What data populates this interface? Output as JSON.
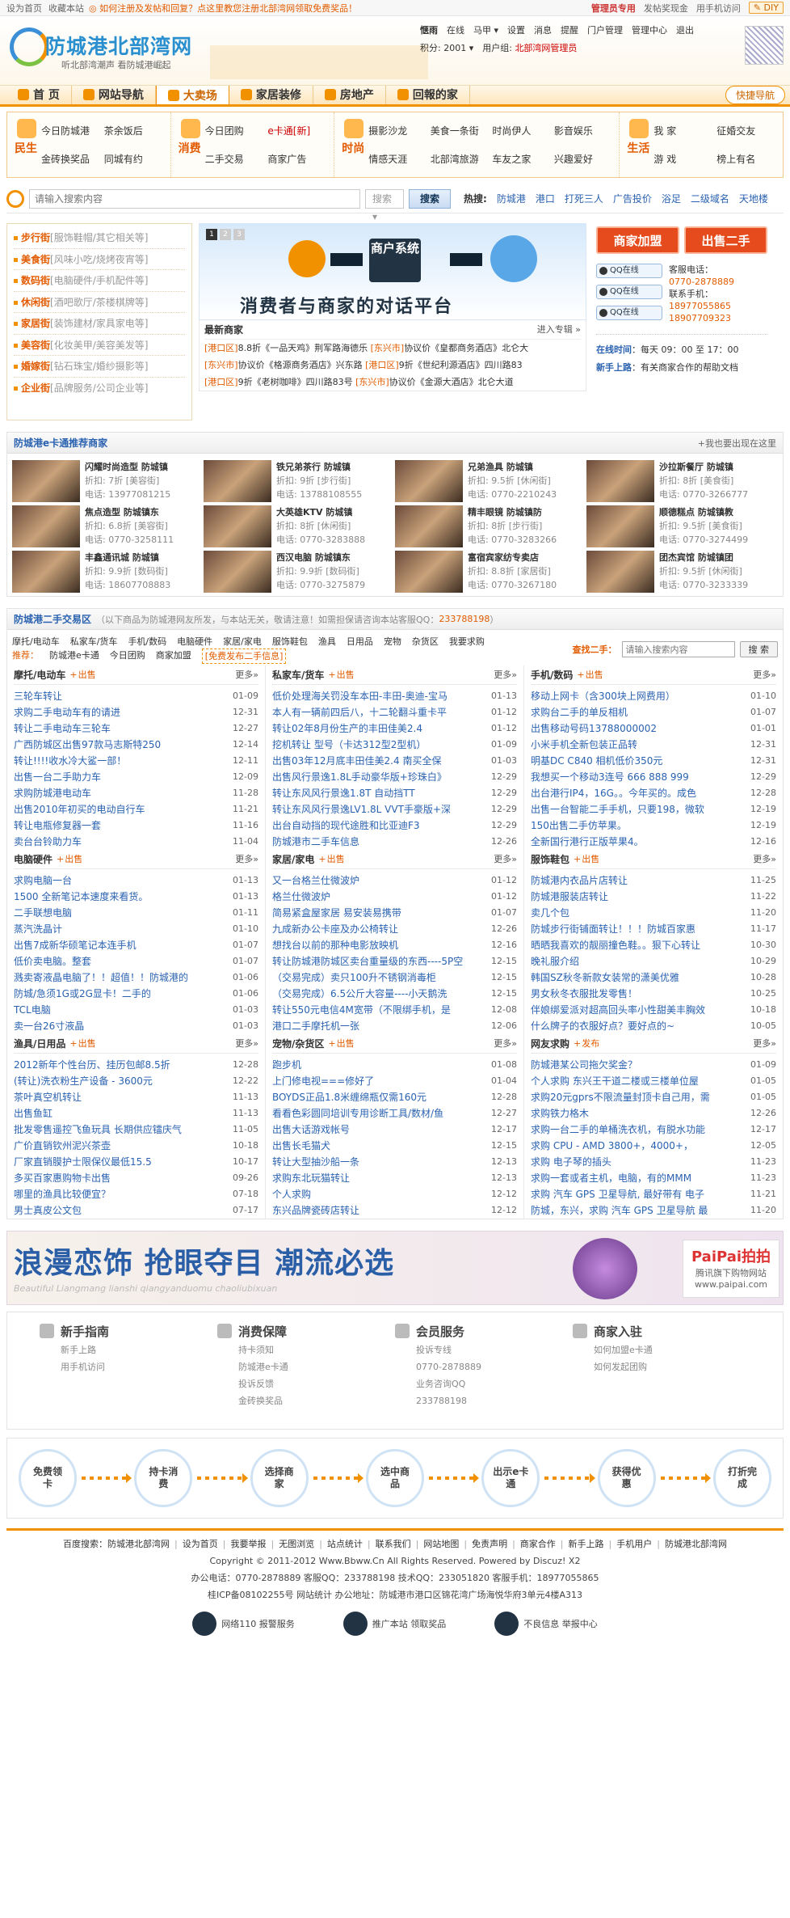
{
  "topbar": {
    "home": "设为首页",
    "fav": "收藏本站",
    "warn": "◎ 如何注册及发帖和回复？点这里教您注册北部湾网领取免费奖品！",
    "links": [
      "管理员专用",
      "发帖奖现金",
      "用手机访问"
    ],
    "diy": "✎ DIY"
  },
  "header": {
    "site_name": "防城港北部湾网",
    "slogan": "听北部湾潮声  看防城港崛起",
    "user": {
      "name": "惬雨",
      "status": "在线",
      "horse": "马甲 ▾",
      "menu": [
        "设置",
        "消息",
        "提醒",
        "门户管理",
        "管理中心",
        "退出"
      ],
      "points_label": "积分: 2001 ▾",
      "group_label": "用户组:",
      "group": "北部湾网管理员"
    }
  },
  "nav": {
    "tabs": [
      "首 页",
      "网站导航",
      "大卖场",
      "家居装修",
      "房地产",
      "回報的家"
    ],
    "quick": "快捷导航"
  },
  "categories": [
    {
      "big": "民生",
      "links": [
        "今日防城港",
        "茶余饭后",
        "金砖换奖品",
        "同城有约"
      ]
    },
    {
      "big": "消费",
      "links": [
        "今日团购",
        "e卡通[新]",
        "二手交易",
        "商家广告"
      ]
    },
    {
      "big": "时尚",
      "links": [
        "摄影沙龙",
        "美食一条街",
        "时尚伊人",
        "影音娱乐",
        "情感天涯",
        "北部湾旅游",
        "车友之家",
        "兴趣爱好"
      ]
    },
    {
      "big": "生活",
      "links": [
        "我 家",
        "征婚交友",
        "游 戏",
        "榜上有名"
      ]
    }
  ],
  "search": {
    "placeholder": "请输入搜索内容",
    "scope": "搜索 ▾",
    "button": "搜索",
    "hot_label": "热搜:",
    "hot": [
      "防城港",
      "港口",
      "打死三人",
      "广告投价",
      "浴足",
      "二级域名",
      "天地楼"
    ]
  },
  "left_cats": [
    {
      "name": "步行街",
      "tags": "[服饰鞋帽/其它相关等]"
    },
    {
      "name": "美食街",
      "tags": "[风味小吃/烧烤夜宵等]"
    },
    {
      "name": "数码街",
      "tags": "[电脑硬件/手机配件等]"
    },
    {
      "name": "休闲街",
      "tags": "[酒吧歌厅/茶楼棋牌等]"
    },
    {
      "name": "家居街",
      "tags": "[装饰建材/家具家电等]"
    },
    {
      "name": "美容街",
      "tags": "[化妆美甲/美容美发等]"
    },
    {
      "name": "婚嫁街",
      "tags": "[钻石珠宝/婚纱摄影等]"
    },
    {
      "name": "企业街",
      "tags": "[品牌服务/公司企业等]"
    }
  ],
  "banner": {
    "pages": [
      "1",
      "2",
      "3"
    ],
    "box": "商户系统",
    "tagline": "消费者与商家的对话平台"
  },
  "newest": {
    "title": "最新商家",
    "more": "进入专辑 »",
    "rows": [
      [
        {
          "loc": "[港口区]",
          "text": "8.8折《一品天鸡》荆军路海德乐"
        },
        {
          "loc": "[东兴市]",
          "text": "协议价《皇都商务酒店》北仑大"
        }
      ],
      [
        {
          "loc": "[东兴市]",
          "text": "协议价《格源商务酒店》兴东路"
        },
        {
          "loc": "[港口区]",
          "text": "9折《世纪利源酒店》四川路83"
        }
      ],
      [
        {
          "loc": "[港口区]",
          "text": "9折《老树咖啡》四川路83号"
        },
        {
          "loc": "[东兴市]",
          "text": "协议价《金源大酒店》北仑大道"
        }
      ]
    ]
  },
  "right": {
    "btn_join": "商家加盟",
    "btn_sell": "出售二手",
    "qq": [
      "QQ在线",
      "QQ在线",
      "QQ在线"
    ],
    "contact": [
      "客服电话：",
      "0770-2878889",
      "联系手机：",
      "18977055865",
      "18907709323"
    ],
    "time_label": "在线时间",
    "time": "：每天 09：00 至 17：00",
    "new_label": "新手上路",
    "new_text": "：有关商家合作的帮助文档"
  },
  "merchants": {
    "title": "防城港e卡通推荐商家",
    "right": "+我也要出现在这里",
    "items": [
      {
        "name": "闪耀时尚造型 防城镇",
        "disc": "折扣: 7折",
        "cat": "[美容街]",
        "tel": "电话: 13977081215"
      },
      {
        "name": "铁兄弟茶行 防城镇",
        "disc": "折扣: 9折",
        "cat": "[步行街]",
        "tel": "电话: 13788108555"
      },
      {
        "name": "兄弟渔具 防城镇",
        "disc": "折扣: 9.5折",
        "cat": "[休闲街]",
        "tel": "电话: 0770-2210243"
      },
      {
        "name": "沙拉斯餐厅 防城镇",
        "disc": "折扣: 8折",
        "cat": "[美食街]",
        "tel": "电话: 0770-3266777"
      },
      {
        "name": "焦点造型 防城镇东",
        "disc": "折扣: 6.8折",
        "cat": "[美容街]",
        "tel": "电话: 0770-3258111"
      },
      {
        "name": "大英雄KTV 防城镇",
        "disc": "折扣: 8折",
        "cat": "[休闲街]",
        "tel": "电话: 0770-3283888"
      },
      {
        "name": "精丰眼镜 防城镇防",
        "disc": "折扣: 8折",
        "cat": "[步行街]",
        "tel": "电话: 0770-3283266"
      },
      {
        "name": "顺德糕点 防城镇教",
        "disc": "折扣: 9.5折",
        "cat": "[美食街]",
        "tel": "电话: 0770-3274499"
      },
      {
        "name": "丰鑫通讯城 防城镇",
        "disc": "折扣: 9.9折",
        "cat": "[数码街]",
        "tel": "电话: 18607708883"
      },
      {
        "name": "西汉电脑 防城镇东",
        "disc": "折扣: 9.9折",
        "cat": "[数码街]",
        "tel": "电话: 0770-3275879"
      },
      {
        "name": "富宿宾家纺专卖店",
        "disc": "折扣: 8.8折",
        "cat": "[家居街]",
        "tel": "电话: 0770-3267180"
      },
      {
        "name": "团杰宾馆 防城镇团",
        "disc": "折扣: 9.5折",
        "cat": "[休闲街]",
        "tel": "电话: 0770-3233339"
      }
    ]
  },
  "trade": {
    "title": "防城港二手交易区",
    "note": "（以下商品为防城港网友所发，与本站无关，敬请注意！如需担保请咨询本站客服QQ：",
    "qq": "233788198",
    "note_end": "）",
    "links": [
      "摩托/电动车",
      "私家车/货车",
      "手机/数码",
      "电脑硬件",
      "家居/家电",
      "服饰鞋包",
      "渔具",
      "日用品",
      "宠物",
      "杂货区",
      "我要求购"
    ],
    "rec_label": "推荐：",
    "rec_links": [
      "防城港e卡通",
      "今日团购",
      "商家加盟"
    ],
    "post": "[免费发布二手信息]",
    "find_label": "查找二手：",
    "find_placeholder": "请输入搜索内容",
    "find_btn": "搜 索"
  },
  "boards": [
    {
      "title": "摩托/电动车",
      "post": "出售",
      "more": "更多»",
      "items": [
        [
          "三轮车转让",
          "01-09"
        ],
        [
          "求购二手电动车有的请进",
          "12-31"
        ],
        [
          "转让二手电动车三轮车",
          "12-27"
        ],
        [
          "广西防城区出售97款马志斯特250",
          "12-14"
        ],
        [
          "转让!!!!收水冷大鲨一部！",
          "12-11"
        ],
        [
          "出售一台二手助力车",
          "12-09"
        ],
        [
          "求购防城港电动车",
          "11-28"
        ],
        [
          "出售2010年初买的电动自行车",
          "11-21"
        ],
        [
          "转让电瓶修复器一套",
          "11-16"
        ],
        [
          "卖台台铃助力车",
          "11-04"
        ]
      ]
    },
    {
      "title": "私家车/货车",
      "post": "出售",
      "more": "更多»",
      "items": [
        [
          "低价处理海关罚没车本田-丰田-奥迪-宝马",
          "01-13"
        ],
        [
          "本人有一辆前四后八，十二轮翻斗重卡平",
          "01-12"
        ],
        [
          "转让02年8月份生产的丰田佳美2.4",
          "01-12"
        ],
        [
          "挖机转让 型号（卡达312型2型机）",
          "01-09"
        ],
        [
          "出售03年12月底丰田佳美2.4 南买全保",
          "01-03"
        ],
        [
          "出售风行景逸1.8L手动豪华版+珍珠白》",
          "12-29"
        ],
        [
          "转让东风风行景逸1.8T 自动挡TT",
          "12-29"
        ],
        [
          "转让东风风行景逸LV1.8L VVT手豪版+深",
          "12-29"
        ],
        [
          "出台自动挡的现代途胜和比亚迪F3",
          "12-29"
        ],
        [
          "防城港市二手车信息",
          "12-26"
        ]
      ]
    },
    {
      "title": "手机/数码",
      "post": "出售",
      "more": "更多»",
      "items": [
        [
          "移动上网卡（含300块上网费用）",
          "01-10"
        ],
        [
          "求购台二手的单反相机",
          "01-07"
        ],
        [
          "出售移动号码13788000002",
          "01-01"
        ],
        [
          "小米手机全新包装正品转",
          "12-31"
        ],
        [
          "明基DC C840 相机低价350元",
          "12-31"
        ],
        [
          "我想买一个移动3连号 666 888 999",
          "12-29"
        ],
        [
          "出台港行IP4，16G。。今年买的。成色",
          "12-28"
        ],
        [
          "出售一台智能二手手机，只要198，微软",
          "12-19"
        ],
        [
          "150出售二手仿苹果。",
          "12-19"
        ],
        [
          "全新国行港行正版苹果4。",
          "12-16"
        ]
      ]
    },
    {
      "title": "电脑硬件",
      "post": "出售",
      "more": "更多»",
      "items": [
        [
          "求购电脑一台",
          "01-13"
        ],
        [
          "1500 全新笔记本速度来看货。",
          "01-13"
        ],
        [
          "二手联想电脑",
          "01-11"
        ],
        [
          "蒸汽洗晶计",
          "01-10"
        ],
        [
          "出售7成新华硕笔记本连手机",
          "01-07"
        ],
        [
          "低价卖电脑。整套",
          "01-07"
        ],
        [
          "溅卖寄液晶电脑了！！超值！！防城港的",
          "01-06"
        ],
        [
          "防城/急须1G或2G显卡！二手的",
          "01-06"
        ],
        [
          "TCL电脑",
          "01-03"
        ],
        [
          "卖一台26寸液晶",
          "01-03"
        ]
      ]
    },
    {
      "title": "家居/家电",
      "post": "出售",
      "more": "更多»",
      "items": [
        [
          "又一台格兰仕微波炉",
          "01-12"
        ],
        [
          "格兰仕微波炉",
          "01-12"
        ],
        [
          "简易紧盒屋家居 易安装易携带",
          "01-07"
        ],
        [
          "九成新办公卡座及办公椅转让",
          "12-26"
        ],
        [
          "想找台以前的那种电影放映机",
          "12-16"
        ],
        [
          "转让防城港防城区卖台重量级的东西----5P空",
          "12-15"
        ],
        [
          "（交易完成）卖只100升不锈钢消毒柜",
          "12-15"
        ],
        [
          "（交易完成）6.5公斤大容量----小天鹅洗",
          "12-15"
        ],
        [
          "转让550元电信4M宽带（不限绑手机，是",
          "12-08"
        ],
        [
          "港口二手摩托机一张",
          "12-06"
        ]
      ]
    },
    {
      "title": "服饰鞋包",
      "post": "出售",
      "more": "更多»",
      "items": [
        [
          "防城港内衣品片店转让",
          "11-25"
        ],
        [
          "防城港服装店转让",
          "11-22"
        ],
        [
          "卖几个包",
          "11-20"
        ],
        [
          "防城步行街铺面转让！！！防城百家惠",
          "11-17"
        ],
        [
          "晒晒我喜欢的靓丽撞色鞋。。狠下心转让",
          "10-30"
        ],
        [
          "晚礼服介绍",
          "10-29"
        ],
        [
          "韩国SZ秋冬新款女装常的潇美优雅",
          "10-28"
        ],
        [
          "男女秋冬衣服批发零售！",
          "10-25"
        ],
        [
          "伴娘绑爱派对超高回头率小性甜美丰胸效",
          "10-18"
        ],
        [
          "什么牌子的衣服好点？要好点的~",
          "10-05"
        ]
      ]
    },
    {
      "title": "渔具/日用品",
      "post": "出售",
      "more": "更多»",
      "items": [
        [
          "2012新年个性台历、挂历包邮8.5折",
          "12-28"
        ],
        [
          "(转让)洗衣粉生产设备 - 3600元",
          "12-22"
        ],
        [
          "茶叶真空机转让",
          "11-13"
        ],
        [
          "出售鱼缸",
          "11-13"
        ],
        [
          "批发零售遥控飞鱼玩具 长期供应镭庆气",
          "11-05"
        ],
        [
          "广价直销钦州泥兴茶壶",
          "10-18"
        ],
        [
          "厂家直销膜护士限保仪最低15.5",
          "10-17"
        ],
        [
          "多买百家惠购物卡出售",
          "09-26"
        ],
        [
          "哪里的渔具比较便宜？",
          "07-18"
        ],
        [
          "男士真皮公文包",
          "07-17"
        ]
      ]
    },
    {
      "title": "宠物/杂货区",
      "post": "出售",
      "more": "更多»",
      "items": [
        [
          "跑步机",
          "01-08"
        ],
        [
          "上门修电视===修好了",
          "01-04"
        ],
        [
          "BOYDS正品1.8米缠绵瓶仅需160元",
          "12-28"
        ],
        [
          "看看色彩圆同培训专用诊断工具/数材/鱼",
          "12-27"
        ],
        [
          "出售大话游戏帐号",
          "12-17"
        ],
        [
          "出售长毛猫犬",
          "12-15"
        ],
        [
          "转让大型抽沙船一条",
          "12-13"
        ],
        [
          "求购东北玩猫转让",
          "12-13"
        ],
        [
          "个人求购",
          "12-12"
        ],
        [
          "东兴品牌瓷砖店转让",
          "12-12"
        ]
      ]
    },
    {
      "title": "网友求购",
      "post": "发布",
      "more": "更多»",
      "items": [
        [
          "防城港某公司拖欠奖金？",
          "01-09"
        ],
        [
          "个人求购 东兴王干道二楼或三楼单位屋",
          "01-05"
        ],
        [
          "求购20元gprs不限流量封顶卡自己用，需",
          "01-05"
        ],
        [
          "求购铁力格木",
          "12-26"
        ],
        [
          "求购一台二手的单桶洗衣机，有脱水功能",
          "12-17"
        ],
        [
          "求购 CPU - AMD 3800+，4000+，",
          "12-05"
        ],
        [
          "求购 电子琴的插头",
          "11-23"
        ],
        [
          "求购一套或者主机，电脑，有的MMM",
          "11-23"
        ],
        [
          "求购 汽车 GPS 卫星导航, 最好带有 电子",
          "11-21"
        ],
        [
          "防城，东兴，求购 汽车 GPS 卫星导航 最",
          "11-20"
        ]
      ]
    }
  ],
  "ad": {
    "headline": "浪漫恋饰 抢眼夺目 潮流必选",
    "sub": "Beautiful Liangmang lianshi qiangyanduomu chaoliubixuan",
    "brand": "PaiPai拍拍",
    "brand_sub": "腾讯旗下购物网站",
    "brand_url": "www.paipai.com"
  },
  "guide": [
    {
      "title": "新手指南",
      "links": [
        "新手上路",
        "用手机访问"
      ]
    },
    {
      "title": "消费保障",
      "links": [
        "持卡须知",
        "防城港e卡通",
        "投诉反馈",
        "金砖换奖品"
      ]
    },
    {
      "title": "会员服务",
      "links": [
        "投诉专线",
        "0770-2878889",
        "业务咨询QQ",
        "233788198"
      ]
    },
    {
      "title": "商家入驻",
      "links": [
        "如何加盟e卡通",
        "如何发起团购"
      ]
    }
  ],
  "steps": [
    "免费领卡",
    "持卡消费",
    "选择商家",
    "选中商品",
    "出示e卡通",
    "获得优惠",
    "打折完成"
  ],
  "footer": {
    "links": [
      "百度搜索：防城港北部湾网",
      "设为首页",
      "我要举报",
      "无图浏览",
      "站点统计",
      "联系我们",
      "网站地图",
      "免责声明",
      "商家合作",
      "新手上路",
      "手机用户",
      "防城港北部湾网"
    ],
    "copyright": "Copyright © 2011-2012 Www.Bbww.Cn All Rights Reserved. Powered by Discuz! X2",
    "contact": "办公电话：0770-2878889  客服QQ：233788198  技术QQ：233051820  客服手机：18977055865",
    "icp": "桂ICP备08102255号  网站统计  办公地址：防城港市港口区锦花湾广场海悦华府3单元4楼A313",
    "badges": [
      "网络110 报警服务",
      "推广本站 领取奖品",
      "不良信息 举报中心"
    ]
  }
}
